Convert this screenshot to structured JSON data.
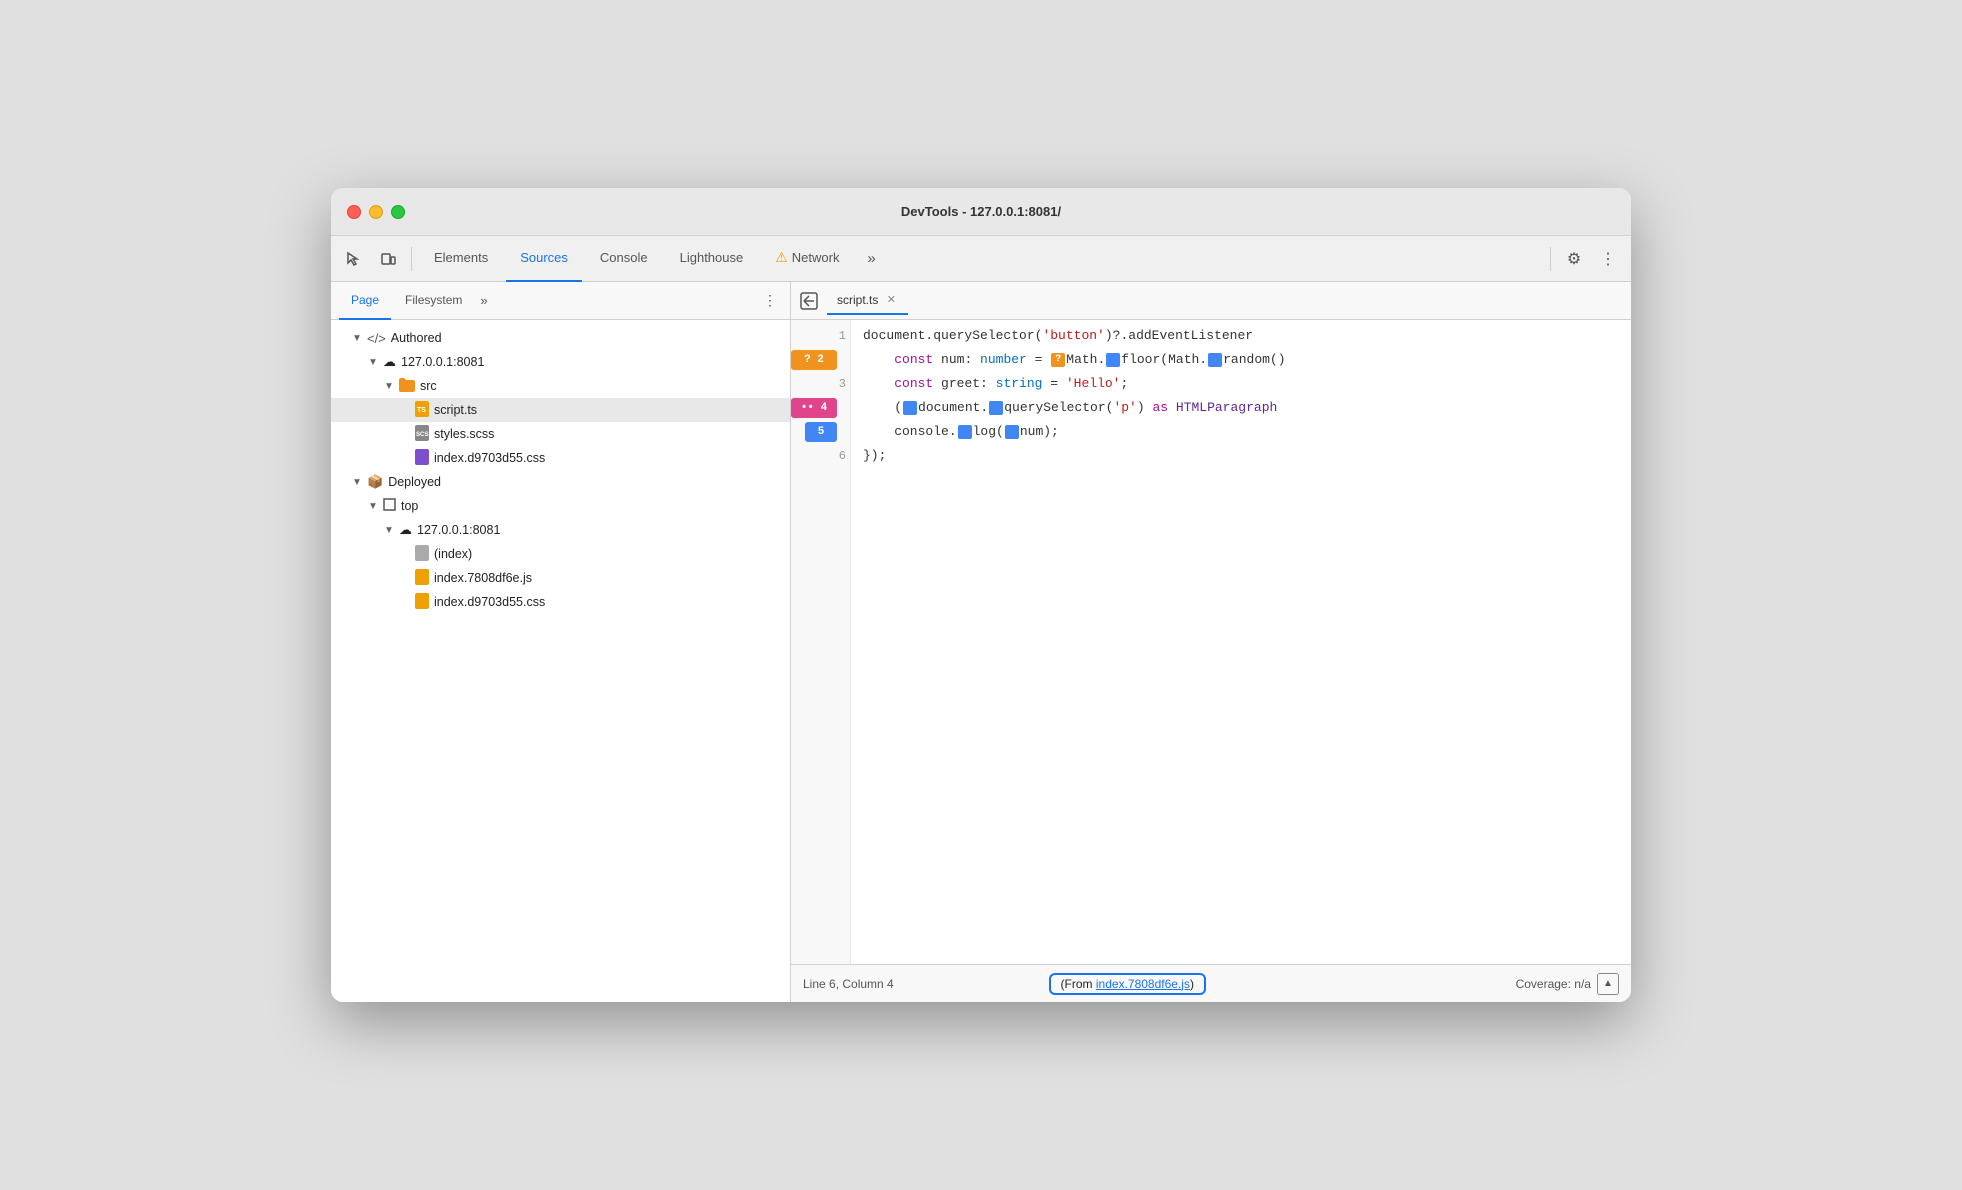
{
  "window": {
    "title": "DevTools - 127.0.0.1:8081/"
  },
  "toolbar": {
    "tabs": [
      {
        "id": "elements",
        "label": "Elements",
        "active": false
      },
      {
        "id": "sources",
        "label": "Sources",
        "active": true
      },
      {
        "id": "console",
        "label": "Console",
        "active": false
      },
      {
        "id": "lighthouse",
        "label": "Lighthouse",
        "active": false
      },
      {
        "id": "network",
        "label": "Network",
        "active": false
      }
    ],
    "more_label": "»",
    "settings_icon": "⚙",
    "dots_icon": "⋮"
  },
  "left_panel": {
    "sub_tabs": [
      {
        "id": "page",
        "label": "Page",
        "active": true
      },
      {
        "id": "filesystem",
        "label": "Filesystem",
        "active": false
      }
    ],
    "more_label": "»",
    "menu_icon": "⋮",
    "tree": [
      {
        "id": "authored",
        "level": 0,
        "arrow": "▼",
        "icon": "</>",
        "label": "Authored",
        "icon_type": "text"
      },
      {
        "id": "authored-host",
        "level": 1,
        "arrow": "▼",
        "icon": "☁",
        "label": "127.0.0.1:8081",
        "icon_type": "cloud"
      },
      {
        "id": "src-folder",
        "level": 2,
        "arrow": "▼",
        "icon": "📁",
        "label": "src",
        "icon_type": "folder-orange"
      },
      {
        "id": "script-ts",
        "level": 3,
        "arrow": "",
        "icon": "📄",
        "label": "script.ts",
        "icon_type": "file-ts",
        "selected": true
      },
      {
        "id": "styles-scss",
        "level": 3,
        "arrow": "",
        "icon": "📄",
        "label": "styles.scss",
        "icon_type": "file-scss"
      },
      {
        "id": "index-css",
        "level": 3,
        "arrow": "",
        "icon": "📄",
        "label": "index.d9703d55.css",
        "icon_type": "file-css"
      },
      {
        "id": "deployed",
        "level": 0,
        "arrow": "▼",
        "icon": "📦",
        "label": "Deployed",
        "icon_type": "box"
      },
      {
        "id": "top",
        "level": 1,
        "arrow": "▼",
        "icon": "□",
        "label": "top",
        "icon_type": "square"
      },
      {
        "id": "deployed-host",
        "level": 2,
        "arrow": "▼",
        "icon": "☁",
        "label": "127.0.0.1:8081",
        "icon_type": "cloud"
      },
      {
        "id": "index-file",
        "level": 3,
        "arrow": "",
        "icon": "📄",
        "label": "(index)",
        "icon_type": "file-gray"
      },
      {
        "id": "index-js",
        "level": 3,
        "arrow": "",
        "icon": "📄",
        "label": "index.7808df6e.js",
        "icon_type": "file-js"
      },
      {
        "id": "index-css2",
        "level": 3,
        "arrow": "",
        "icon": "📄",
        "label": "index.d9703d55.css",
        "icon_type": "file-css2"
      }
    ]
  },
  "editor": {
    "open_tab": "script.ts",
    "back_icon": "◀|",
    "lines": [
      {
        "num": 1,
        "breakpoint": null,
        "content": "document.querySelector('button')?.addEventListener"
      },
      {
        "num": 2,
        "breakpoint": "orange",
        "breakpoint_label": "? 2",
        "content_parts": [
          {
            "text": "    const num: number = ",
            "class": "c-default"
          },
          {
            "text": "?",
            "class": "type-q"
          },
          {
            "text": "Math.",
            "class": "c-default"
          },
          {
            "text": "D",
            "class": "type-badge"
          },
          {
            "text": "floor(Math.",
            "class": "c-default"
          },
          {
            "text": "D",
            "class": "type-badge"
          },
          {
            "text": "random()",
            "class": "c-default"
          }
        ]
      },
      {
        "num": 3,
        "breakpoint": null,
        "content_parts": [
          {
            "text": "    const greet: string = ",
            "class": "c-default"
          },
          {
            "text": "'Hello'",
            "class": "c-string"
          },
          {
            "text": ";",
            "class": "c-default"
          }
        ]
      },
      {
        "num": 4,
        "breakpoint": "pink",
        "breakpoint_label": "•• 4",
        "content_parts": [
          {
            "text": "    (",
            "class": "c-default"
          },
          {
            "text": "D",
            "class": "type-badge"
          },
          {
            "text": "document.",
            "class": "c-default"
          },
          {
            "text": "D",
            "class": "type-badge"
          },
          {
            "text": "querySelector(",
            "class": "c-default"
          },
          {
            "text": "'p'",
            "class": "c-string"
          },
          {
            "text": ") as HTMLParagraph",
            "class": "c-class"
          }
        ]
      },
      {
        "num": 5,
        "breakpoint": "blue",
        "breakpoint_label": "5",
        "content_parts": [
          {
            "text": "    console.",
            "class": "c-default"
          },
          {
            "text": "D",
            "class": "type-badge"
          },
          {
            "text": "log(",
            "class": "c-default"
          },
          {
            "text": "D",
            "class": "type-badge"
          },
          {
            "text": "num);",
            "class": "c-default"
          }
        ]
      },
      {
        "num": 6,
        "breakpoint": null,
        "content_parts": [
          {
            "text": "});",
            "class": "c-default"
          }
        ]
      }
    ]
  },
  "status_bar": {
    "position": "Line 6, Column 4",
    "source_label": "(From index.7808df6e.js)",
    "source_link": "index.7808df6e.js",
    "coverage_label": "Coverage: n/a",
    "coverage_icon": "▲"
  }
}
